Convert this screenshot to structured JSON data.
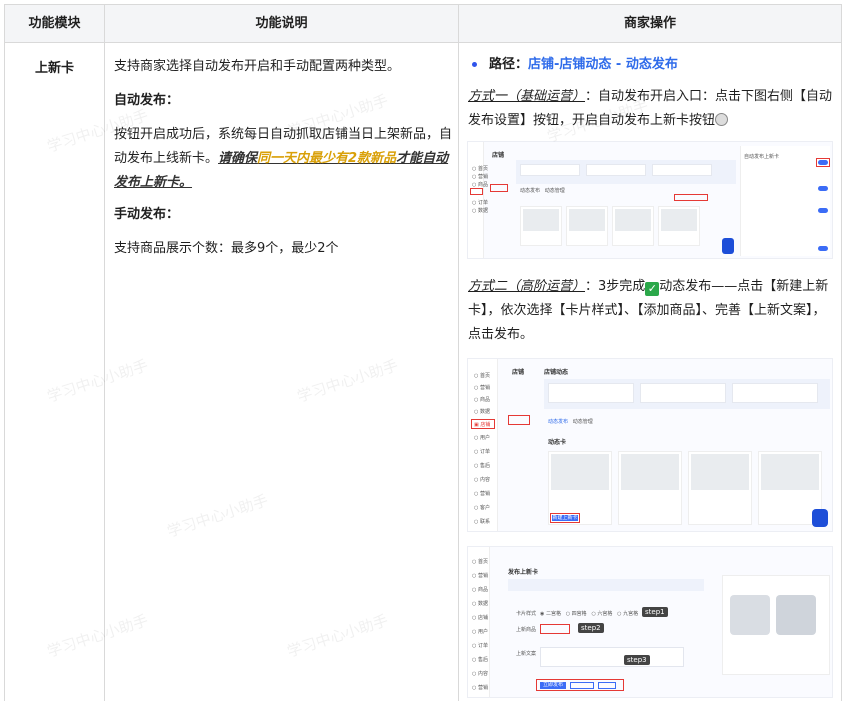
{
  "table": {
    "headers": [
      "功能模块",
      "功能说明",
      "商家操作"
    ]
  },
  "row": {
    "module": "上新卡",
    "description": {
      "intro": "支持商家选择自动发布开启和手动配置两种类型。",
      "auto_title": "自动发布：",
      "auto_text": "按钮开启成功后，系统每日自动抓取店铺当日上架新品，自动发布上线新卡。",
      "auto_note_prefix": "请确保",
      "auto_note_highlight": "同一天内最少有2款新品",
      "auto_note_suffix": "才能自动发布上新卡。",
      "manual_title": "手动发布：",
      "manual_text": "支持商品展示个数：最多9个，最少2个"
    },
    "operations": {
      "path_label": "路径：",
      "path_value": "店铺-店铺动态 - 动态发布",
      "way1_label": "方式一（基础运营）",
      "way1_text": "：自动发布开启入口：点击下图右侧【自动发布设置】按钮，开启自动发布上新卡按钮",
      "way2_label": "方式二（高阶运营）",
      "way2_text_a": "：3步完成",
      "way2_text_b": "动态发布——点击【新建上新卡】，依次选择【卡片样式】、【添加商品】、完善【上新文案】，点击发布。"
    },
    "screenshots": {
      "shop_label": "店铺",
      "dynamic_label": "店铺动态",
      "card_label": "动态卡",
      "new_card_btn": "新建上新卡",
      "publish_title": "发布上新卡",
      "card_style": "卡片样式",
      "add_goods": "上新商品",
      "copywriting": "上新文案",
      "publish_btn": "立即发布",
      "step1": "step1",
      "step2": "step2",
      "step3": "step3"
    }
  },
  "watermark": "学习中心小助手",
  "colors": {
    "highlight": "#d9a008",
    "link_blue": "#2f6bea",
    "check_green": "#2ba84a"
  }
}
